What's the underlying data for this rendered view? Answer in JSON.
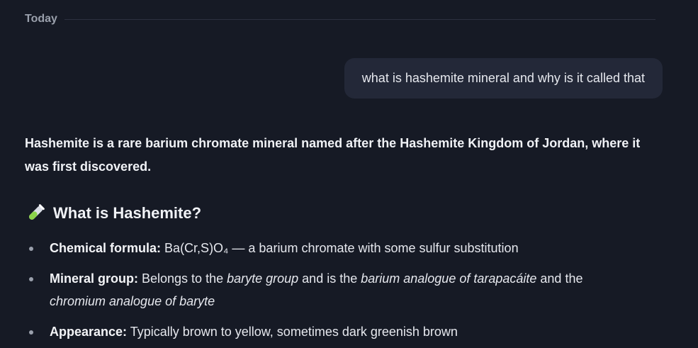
{
  "divider": {
    "label": "Today"
  },
  "user_message": "what is hashemite mineral and why is it called that",
  "answer": {
    "summary": "Hashemite is a rare barium chromate mineral named after the Hashemite Kingdom of Jordan, where it was first discovered.",
    "section_heading": "What is Hashemite?",
    "section_icon": "test-tube-icon",
    "bullets": [
      {
        "label": "Chemical formula:",
        "text": " Ba(Cr,S)O₄ — a barium chromate with some sulfur substitution"
      },
      {
        "label": "Mineral group:",
        "text_a": " Belongs to the ",
        "em_a": "baryte group",
        "text_b": " and is the ",
        "em_b": "barium analogue of tarapacáite",
        "text_c": " and the ",
        "em_c": "chromium analogue of baryte"
      },
      {
        "label": "Appearance:",
        "text": " Typically brown to yellow, sometimes dark greenish brown"
      }
    ]
  },
  "colors": {
    "background": "#161a25",
    "bubble": "#232838",
    "muted": "#9aa0ac"
  }
}
